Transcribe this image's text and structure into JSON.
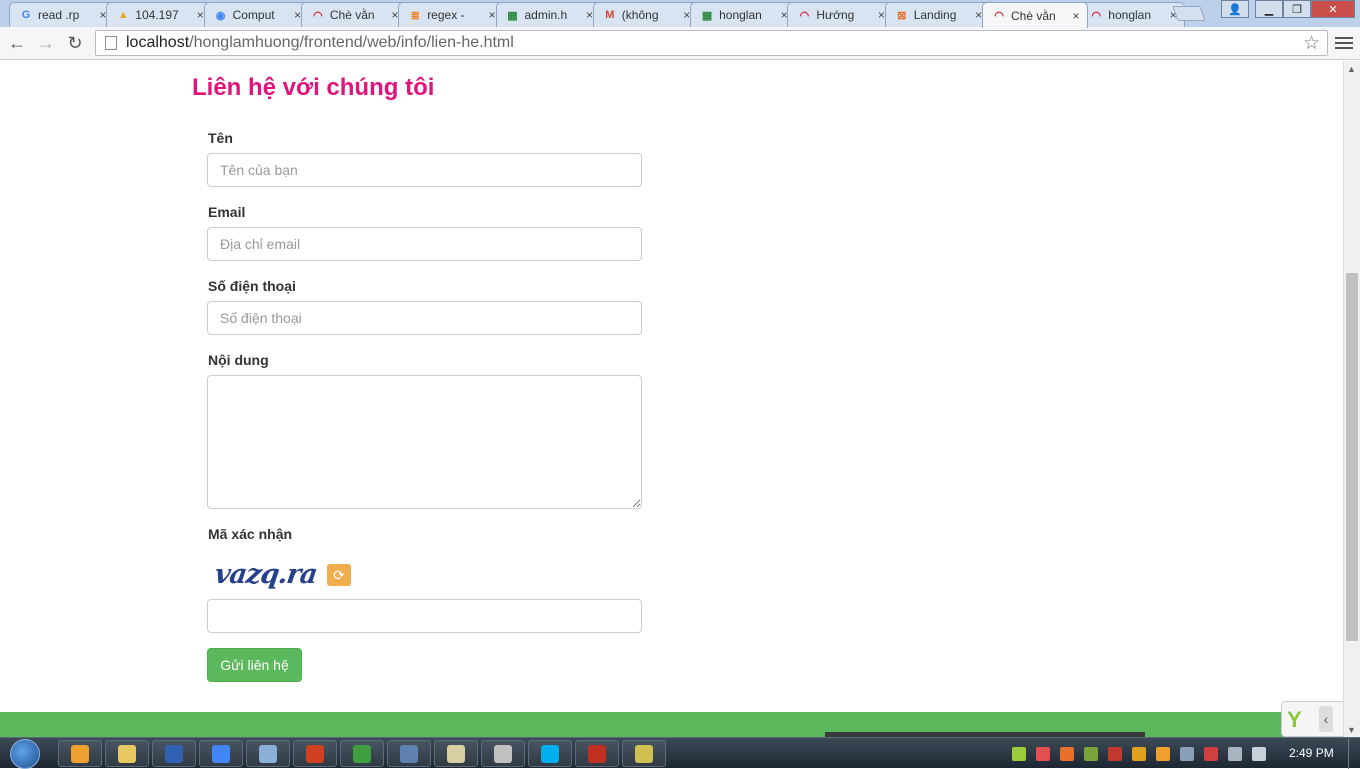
{
  "browser": {
    "tabs": [
      {
        "title": "read .rp",
        "icon": "google-icon",
        "color": "#4285f4",
        "glyph": "G"
      },
      {
        "title": "104.197",
        "icon": "phpmyadmin-icon",
        "color": "#e8a72c",
        "glyph": "▲"
      },
      {
        "title": "Comput",
        "icon": "chrome-icon",
        "color": "#4285f4",
        "glyph": "◉"
      },
      {
        "title": "Chè vằn",
        "icon": "wifi-icon",
        "color": "#d0202e",
        "glyph": "◠"
      },
      {
        "title": "regex -",
        "icon": "stackoverflow-icon",
        "color": "#f48024",
        "glyph": "≣"
      },
      {
        "title": "admin.h",
        "icon": "windows-icon",
        "color": "#2d8a3e",
        "glyph": "▦"
      },
      {
        "title": "(không",
        "icon": "gmail-icon",
        "color": "#d44638",
        "glyph": "M"
      },
      {
        "title": "honglan",
        "icon": "windows-icon",
        "color": "#2d8a3e",
        "glyph": "▦"
      },
      {
        "title": "Hướng",
        "icon": "wifi-icon",
        "color": "#d0202e",
        "glyph": "◠"
      },
      {
        "title": "Landing",
        "icon": "xampp-icon",
        "color": "#e8702a",
        "glyph": "⊠"
      },
      {
        "title": "Chè vằn",
        "icon": "wifi-icon",
        "color": "#d0202e",
        "glyph": "◠",
        "active": true
      },
      {
        "title": "honglan",
        "icon": "wifi-icon",
        "color": "#d0202e",
        "glyph": "◠"
      }
    ],
    "url_host": "localhost",
    "url_path": "/honglamhuong/frontend/web/info/lien-he.html"
  },
  "page": {
    "heading": "Liên hệ với chúng tôi",
    "form": {
      "name_label": "Tên",
      "name_placeholder": "Tên của bạn",
      "email_label": "Email",
      "email_placeholder": "Địa chỉ email",
      "phone_label": "Số điện thoại",
      "phone_placeholder": "Số điện thoại",
      "content_label": "Nội dung",
      "captcha_label": "Mã xác nhận",
      "captcha_text": "vazq.ra",
      "submit_label": "Gửi liên hệ"
    },
    "colors": {
      "heading": "#e0147c",
      "submit": "#5cb85c",
      "refresh": "#f0ad4e",
      "footer": "#5cb85c"
    }
  },
  "taskbar": {
    "clock": "2:49 PM",
    "apps": [
      "media-player-icon",
      "explorer-icon",
      "visual-studio-icon",
      "chrome-icon",
      "virtualbox-icon",
      "git-icon",
      "sourcetree-icon",
      "app-icon",
      "notepad-icon",
      "snipping-tool-icon",
      "skype-icon",
      "filezilla-icon",
      "editor-icon"
    ]
  }
}
